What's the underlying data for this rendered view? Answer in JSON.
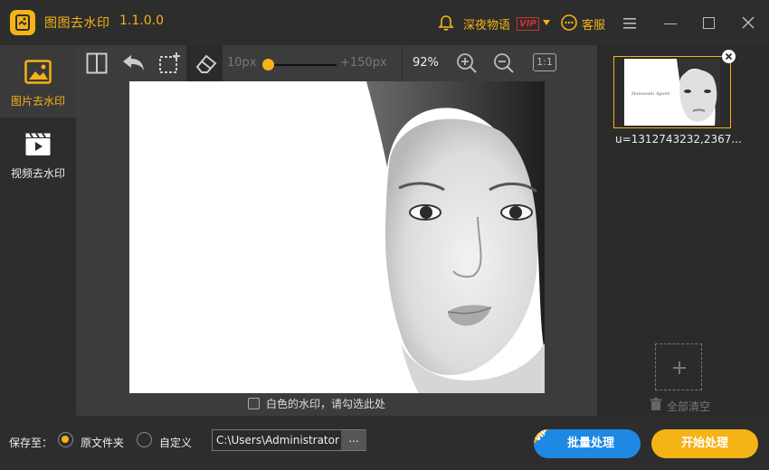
{
  "titlebar": {
    "app_name": "图图去水印",
    "version": "1.1.0.0",
    "user_name": "深夜物语",
    "vip_badge": "VIP",
    "service_label": "客服"
  },
  "sidebar": {
    "items": [
      {
        "label": "图片去水印",
        "icon": "image-icon",
        "active": true
      },
      {
        "label": "视频去水印",
        "icon": "video-icon",
        "active": false
      }
    ]
  },
  "toolbar": {
    "brush_min": "10px",
    "brush_max": "+150px",
    "brush_level": 0.0,
    "zoom": "92%",
    "fit_label": "1:1"
  },
  "canvas": {
    "white_watermark_label": "白色的水印，请勾选此处"
  },
  "files": {
    "items": [
      {
        "name": "u=1312743232,2367..."
      }
    ],
    "clear_all_label": "全部清空",
    "thumb_caption": "Hamasaki Ayumi"
  },
  "bottom": {
    "save_to_label": "保存至：",
    "options": [
      {
        "label": "原文件夹",
        "checked": true
      },
      {
        "label": "自定义",
        "checked": false
      }
    ],
    "path": "C:\\Users\\Administrator",
    "browse_label": "...",
    "batch_label": "批量处理",
    "batch_vip": "VIP",
    "start_label": "开始处理"
  },
  "colors": {
    "accent": "#f5b315",
    "batch_blue": "#1e88e5",
    "background": "#2b2b2b"
  }
}
